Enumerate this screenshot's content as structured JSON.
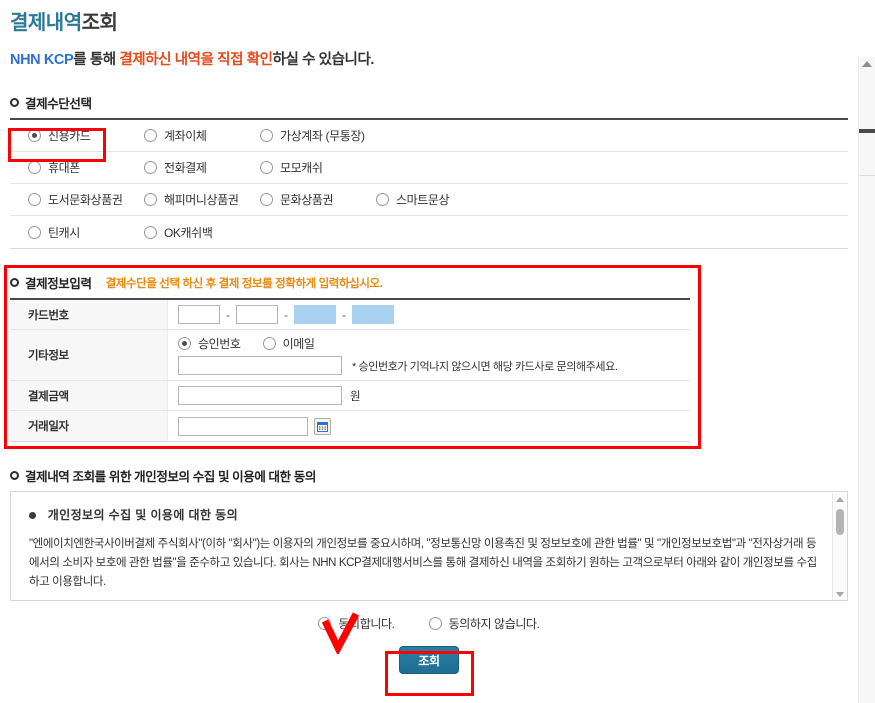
{
  "page": {
    "title_highlight": "결제내역",
    "title_rest": "조회",
    "subtitle_blue": "NHN KCP",
    "subtitle_mid": "를 통해 ",
    "subtitle_red": "결제하신 내역을 직접 확인",
    "subtitle_end": "하실 수 있습니다."
  },
  "colors": {
    "title_accent": "#2b7a99",
    "subtitle_blue": "#2f6fd0",
    "subtitle_red": "#e8491d",
    "note_orange": "#e98a12",
    "annotation_red": "#ff0000",
    "button_teal": "#24739a",
    "masked_input": "#a8d2f0"
  },
  "payment_method": {
    "heading": "결제수단선택",
    "rows": [
      [
        {
          "label": "신용카드",
          "checked": true
        },
        {
          "label": "계좌이체",
          "checked": false
        },
        {
          "label": "가상계좌 (무통장)",
          "checked": false
        }
      ],
      [
        {
          "label": "휴대폰",
          "checked": false
        },
        {
          "label": "전화결제",
          "checked": false
        },
        {
          "label": "모모캐쉬",
          "checked": false
        }
      ],
      [
        {
          "label": "도서문화상품권",
          "checked": false
        },
        {
          "label": "해피머니상품권",
          "checked": false
        },
        {
          "label": "문화상품권",
          "checked": false
        },
        {
          "label": "스마트문상",
          "checked": false
        }
      ],
      [
        {
          "label": "틴캐시",
          "checked": false
        },
        {
          "label": "OK캐쉬백",
          "checked": false
        }
      ]
    ]
  },
  "payment_info": {
    "heading": "결제정보입력",
    "note": "결제수단을 선택 하신 후 결제 정보를 정확하게 입력하십시오.",
    "card_number": {
      "label": "카드번호",
      "segments": [
        {
          "value": "",
          "masked": false
        },
        {
          "value": "",
          "masked": false
        },
        {
          "value": "",
          "masked": true
        },
        {
          "value": "",
          "masked": true
        }
      ],
      "separator": "-"
    },
    "etc_info": {
      "label": "기타정보",
      "options": [
        {
          "label": "승인번호",
          "checked": true
        },
        {
          "label": "이메일",
          "checked": false
        }
      ],
      "value": "",
      "hint": "* 승인번호가 기억나지 않으시면 해당 카드사로 문의해주세요."
    },
    "amount": {
      "label": "결제금액",
      "value": "",
      "unit": "원"
    },
    "date": {
      "label": "거래일자",
      "value": "",
      "icon": "calendar-icon"
    }
  },
  "consent": {
    "heading": "결제내역 조회를 위한 개인정보의 수집 및 이용에 대한 동의",
    "box_title": "개인정보의 수집 및 이용에 대한 동의",
    "box_text": "\"엔에이치엔한국사이버결제 주식회사\"(이하 \"회사\")는 이용자의 개인정보를 중요시하며, \"정보통신망 이용촉진 및 정보보호에 관한 법률\" 및 \"개인정보보호법\"과 \"전자상거래 등에서의 소비자 보호에 관한 법률\"을 준수하고 있습니다. 회사는 NHN KCP결제대행서비스를 통해 결제하신 내역을 조회하기 원하는 고객으로부터 아래와 같이 개인정보를 수집하고 이용합니다.",
    "agree_options": [
      {
        "label": "동의합니다.",
        "checked": false
      },
      {
        "label": "동의하지 않습니다.",
        "checked": false
      }
    ]
  },
  "submit": {
    "label": "조회"
  }
}
